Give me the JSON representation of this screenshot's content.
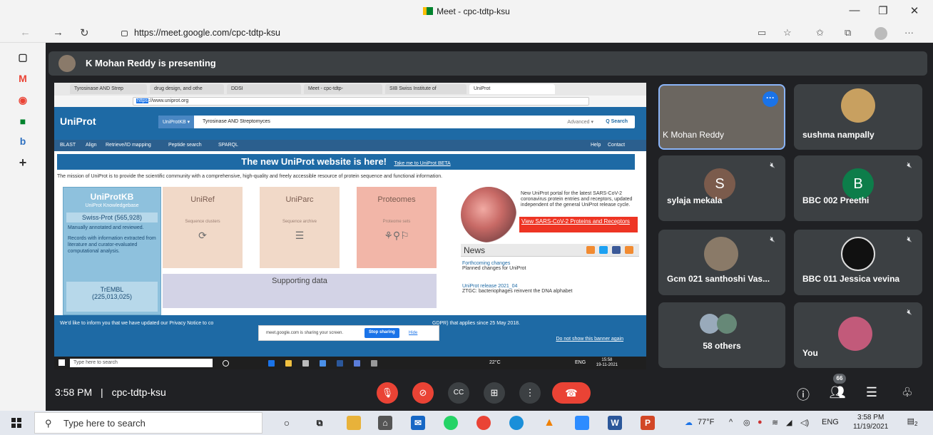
{
  "window": {
    "title": "Meet - cpc-tdtp-ksu",
    "url": "https://meet.google.com/cpc-tdtp-ksu"
  },
  "meet": {
    "presenter_text": "K Mohan Reddy is presenting",
    "time": "3:58 PM",
    "separator": "|",
    "meeting_code": "cpc-tdtp-ksu",
    "participants_count": "66",
    "tiles": [
      {
        "name": "K Mohan Reddy"
      },
      {
        "name": "sushma nampally"
      },
      {
        "name": "sylaja mekala",
        "initial": "S",
        "color": "#7b5b4c"
      },
      {
        "name": "BBC 002 Preethi",
        "initial": "B",
        "color": "#0d7d4a"
      },
      {
        "name": "Gcm 021 santhoshi Vas..."
      },
      {
        "name": "BBC 011 Jessica vevina"
      },
      {
        "name": "58 others"
      },
      {
        "name": "You"
      }
    ]
  },
  "shared_screen": {
    "tabs": [
      "Tyrosinase AND Strep",
      "drug design, and othe",
      "DDSI",
      "Meet - cpc-tdtp-",
      "SIB Swiss Institute of",
      "UniProt"
    ],
    "url_selected": "https",
    "url_rest": "://www.uniprot.org",
    "uniprot": {
      "logo": "UniProt",
      "db_select": "UniProtKB ▾",
      "query": "Tyrosinase AND Streptomyces",
      "advanced": "Advanced ▾",
      "search": "Q Search",
      "nav": [
        "BLAST",
        "Align",
        "Retrieve/ID mapping",
        "Peptide search",
        "SPARQL"
      ],
      "nav_right": [
        "Help",
        "Contact"
      ],
      "banner_main": "The new UniProt website is here!",
      "banner_link": "Take me to UniProt BETA",
      "mission": "The mission of UniProt is to provide the scientific community with a comprehensive, high-quality and freely accessible resource of protein sequence and functional information.",
      "kb_title": "UniProtKB",
      "kb_sub": "UniProt Knowledgebase",
      "swissprot": "Swiss-Prot (565,928)",
      "swissprot_desc": "Manually annotated and reviewed.",
      "records_desc": "Records with information extracted from literature and curator-evaluated computational analysis.",
      "trembl": "TrEMBL",
      "trembl_count": "(225,013,025)",
      "uniref": "UniRef",
      "uniref_sub": "Sequence clusters",
      "uniparc": "UniParc",
      "uniparc_sub": "Sequence archive",
      "proteomes": "Proteomes",
      "proteomes_sub": "Proteome sets",
      "supporting": "Supporting data",
      "cov_text": "New UniProt portal for the latest SARS-CoV-2 coronavirus protein entries and receptors, updated independent of the general UniProt release cycle.",
      "cov_link": "View SARS-CoV-2 Proteins and Receptors",
      "news_title": "News",
      "news_items": [
        {
          "link": "Forthcoming changes",
          "text": "Planned changes for UniProt"
        },
        {
          "link": "UniProt release 2021_04",
          "text": "ZTGC: bacteriophages reinvent the DNA alphabet"
        }
      ],
      "cookie_text": "We'd like to inform you that we have updated our Privacy Notice to co",
      "cookie_text2": "GDPR) that applies since 25 May 2018.",
      "dont_show": "Do not show this banner again"
    },
    "share_popup": {
      "message": "meet.google.com is sharing your screen.",
      "stop": "Stop sharing",
      "hide": "Hide"
    },
    "taskbar": {
      "search": "Type here to search",
      "weather": "22°C",
      "lang": "ENG",
      "time": "15:58",
      "date": "19-11-2021"
    }
  },
  "taskbar": {
    "search_placeholder": "Type here to search",
    "weather": "77°F",
    "lang": "ENG",
    "time": "3:58 PM",
    "date": "11/19/2021",
    "notif_count": "2"
  }
}
